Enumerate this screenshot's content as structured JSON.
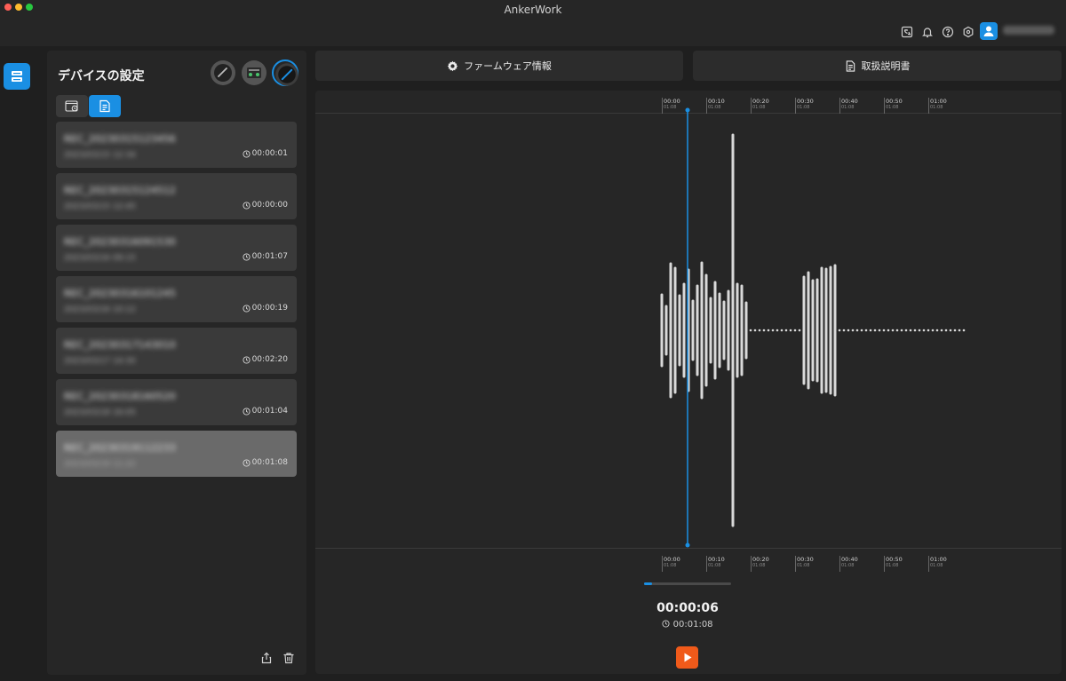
{
  "window": {
    "title": "AnkerWork"
  },
  "topbar": {
    "icons": [
      "language-icon",
      "bell-icon",
      "help-icon",
      "settings-hex-icon"
    ],
    "accent": "#1a8fe3"
  },
  "device_panel": {
    "title": "デバイスの設定",
    "devices": [
      "device-speakerphone",
      "device-mixer",
      "device-selected"
    ],
    "tabs": [
      "camera-folder-tab",
      "file-list-tab"
    ],
    "recordings": [
      {
        "name": "REC_20230315123456",
        "date": "2023/03/15 12:34",
        "duration": "00:00:01",
        "selected": false
      },
      {
        "name": "REC_20230315124512",
        "date": "2023/03/15 12:45",
        "duration": "00:00:00",
        "selected": false
      },
      {
        "name": "REC_20230316091530",
        "date": "2023/03/16 09:15",
        "duration": "00:01:07",
        "selected": false
      },
      {
        "name": "REC_20230316101245",
        "date": "2023/03/16 10:12",
        "duration": "00:00:19",
        "selected": false
      },
      {
        "name": "REC_20230317143010",
        "date": "2023/03/17 14:30",
        "duration": "00:02:20",
        "selected": false
      },
      {
        "name": "REC_20230318160520",
        "date": "2023/03/18 16:05",
        "duration": "00:01:04",
        "selected": false
      },
      {
        "name": "REC_20230319112233",
        "date": "2023/03/19 11:22",
        "duration": "00:01:08",
        "selected": true
      }
    ]
  },
  "actions": {
    "firmware": "ファームウェア情報",
    "manual": "取扱説明書"
  },
  "player": {
    "ruler": [
      {
        "time": "00:00",
        "sub": "01:08"
      },
      {
        "time": "00:10",
        "sub": "01:08"
      },
      {
        "time": "00:20",
        "sub": "01:08"
      },
      {
        "time": "00:30",
        "sub": "01:08"
      },
      {
        "time": "00:40",
        "sub": "01:08"
      },
      {
        "time": "00:50",
        "sub": "01:08"
      },
      {
        "time": "01:00",
        "sub": "01:08"
      }
    ],
    "current_time": "00:00:06",
    "total_time": "00:01:08",
    "progress": 0.09,
    "play_color": "#f05a1a"
  }
}
